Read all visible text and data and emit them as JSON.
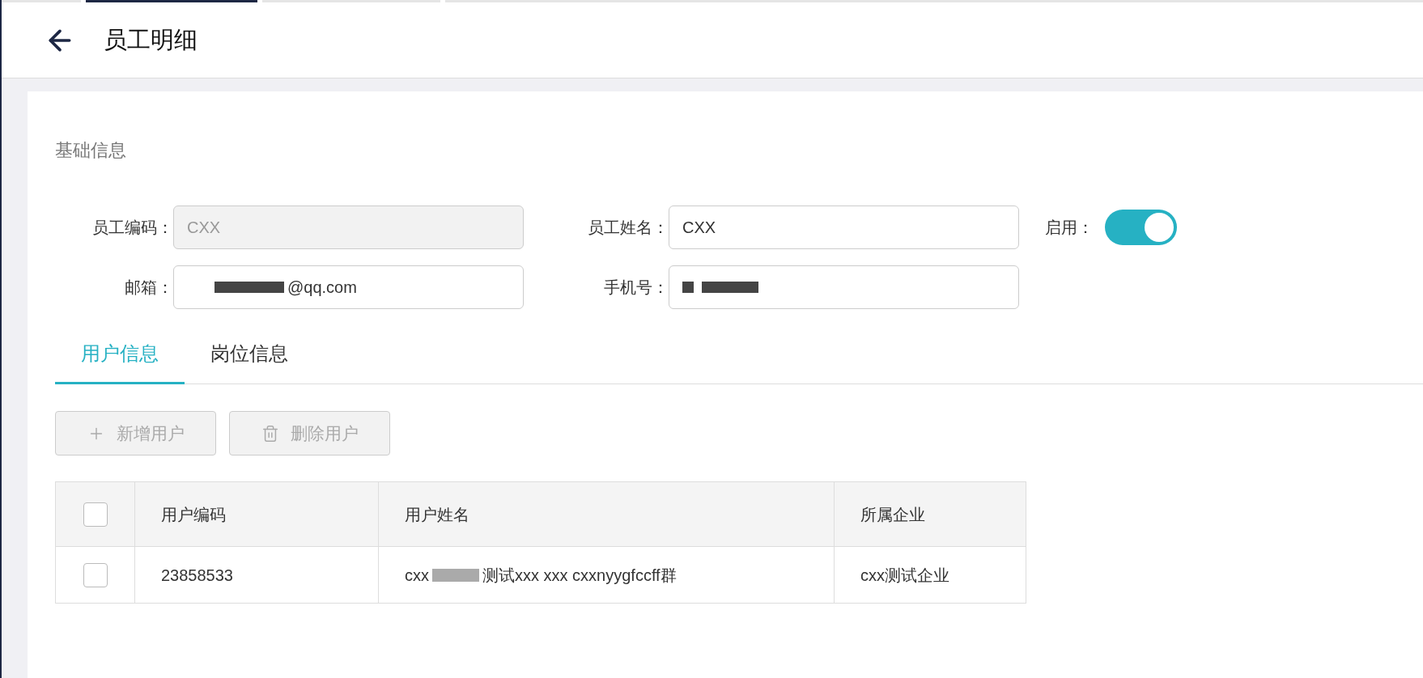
{
  "header": {
    "title": "员工明细"
  },
  "section_title": "基础信息",
  "form": {
    "code": {
      "label": "员工编码：",
      "value": "CXX",
      "disabled": true
    },
    "name": {
      "label": "员工姓名：",
      "value": "CXX"
    },
    "enabled": {
      "label": "启用：",
      "on": true
    },
    "email": {
      "label": "邮箱：",
      "value": "@qq.com"
    },
    "phone": {
      "label": "手机号："
    }
  },
  "tabs": [
    {
      "label": "用户信息",
      "selected": true
    },
    {
      "label": "岗位信息",
      "selected": false
    }
  ],
  "buttons": [
    {
      "kind": "add",
      "label": "新增用户",
      "disabled": true
    },
    {
      "kind": "delete",
      "label": "删除用户",
      "disabled": true
    }
  ],
  "table": {
    "columns": [
      "用户编码",
      "用户姓名",
      "所属企业"
    ],
    "header_checked": false,
    "rows": [
      {
        "checked": false,
        "cells": [
          "23858533",
          {
            "before": "cxx",
            "after": "测试xxx xxx cxxnyygfccff群"
          },
          "cxx测试企业"
        ]
      }
    ]
  }
}
